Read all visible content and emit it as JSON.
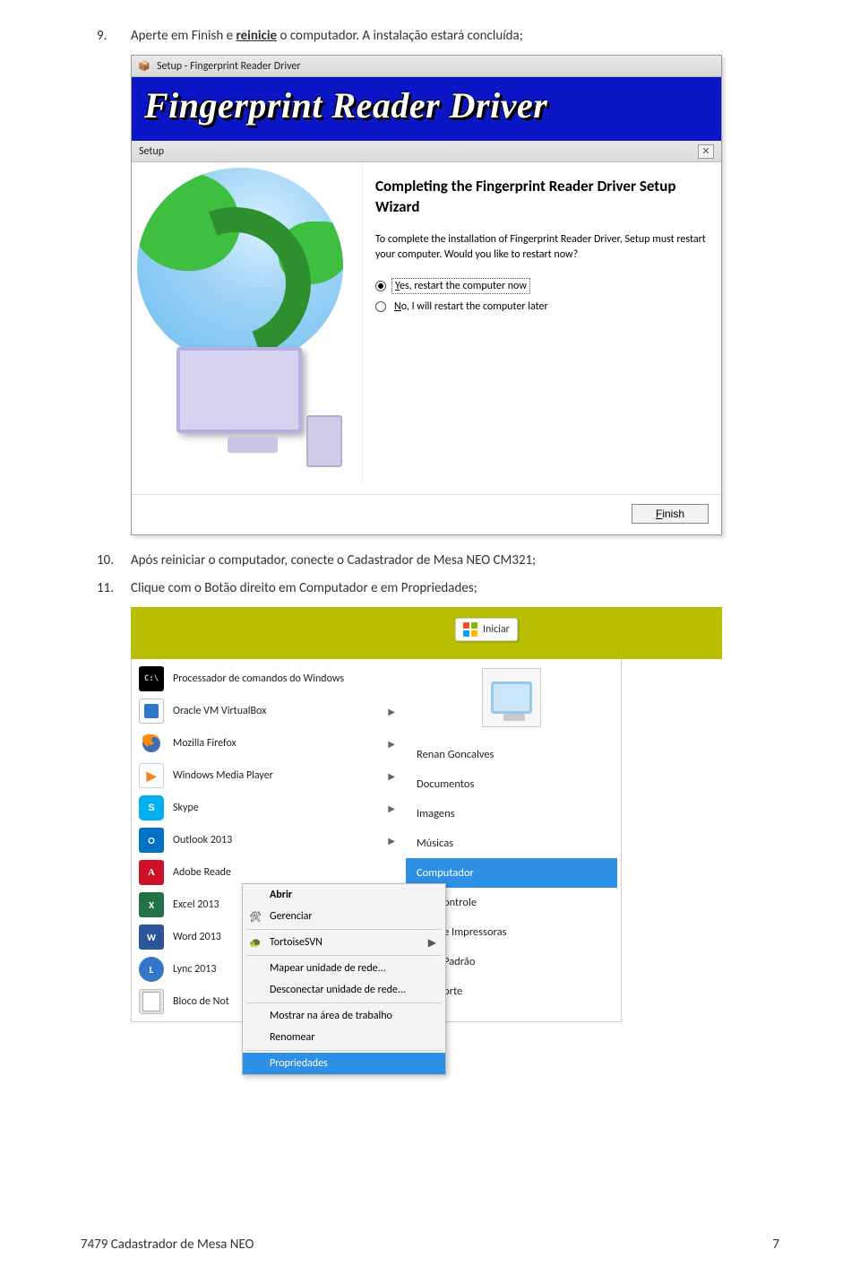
{
  "instructions": {
    "i9": {
      "num": "9.",
      "text_a": "Aperte em Finish e ",
      "text_b": "reinicie",
      "text_c": " o computador. A instalação estará concluída;"
    },
    "i10": {
      "num": "10.",
      "text": "Após reiniciar o computador, conecte o Cadastrador de Mesa NEO CM321;"
    },
    "i11": {
      "num": "11.",
      "text": "Clique com o Botão direito em Computador e em Propriedades;"
    }
  },
  "installer": {
    "window_title": "Setup - Fingerprint Reader Driver",
    "banner_title": "Fingerprint Reader Driver",
    "inner_title": "Setup",
    "heading": "Completing the Fingerprint Reader Driver Setup Wizard",
    "desc": "To complete the installation of Fingerprint Reader Driver, Setup must restart your computer. Would you like to restart now?",
    "radio_yes_pre": "Y",
    "radio_yes_post": "es, restart the computer now",
    "radio_no_pre": "N",
    "radio_no_post": "o, I will restart the computer later",
    "finish_pre": "F",
    "finish_post": "inish"
  },
  "startmenu": {
    "iniciar": "Iniciar",
    "left": [
      {
        "label": "Processador de comandos do Windows",
        "arrow": false
      },
      {
        "label": "Oracle VM VirtualBox",
        "arrow": true
      },
      {
        "label": "Mozilla Firefox",
        "arrow": true
      },
      {
        "label": "Windows Media Player",
        "arrow": true
      },
      {
        "label": "Skype",
        "arrow": true
      },
      {
        "label": "Outlook 2013",
        "arrow": true
      },
      {
        "label": "Adobe Reade",
        "arrow": false
      },
      {
        "label": "Excel 2013",
        "arrow": false
      },
      {
        "label": "Word 2013",
        "arrow": false
      },
      {
        "label": "Lync 2013",
        "arrow": false
      },
      {
        "label": "Bloco de Not",
        "arrow": false
      }
    ],
    "right": {
      "user": "Renan Goncalves",
      "documentos": "Documentos",
      "imagens": "Imagens",
      "musicas": "Músicas",
      "computador": "Computador",
      "controle": "ontrole",
      "impressoras": "e Impressoras",
      "padrao": "Padrão",
      "suporte": "orte"
    },
    "ctx": {
      "abrir": "Abrir",
      "gerenciar": "Gerenciar",
      "tortoise": "TortoiseSVN",
      "mapear": "Mapear unidade de rede...",
      "desconectar": "Desconectar unidade de rede...",
      "mostrar": "Mostrar na área de trabalho",
      "renomear": "Renomear",
      "propriedades": "Propriedades"
    }
  },
  "footer": {
    "left": "7479 Cadastrador de Mesa NEO",
    "right": "7"
  }
}
